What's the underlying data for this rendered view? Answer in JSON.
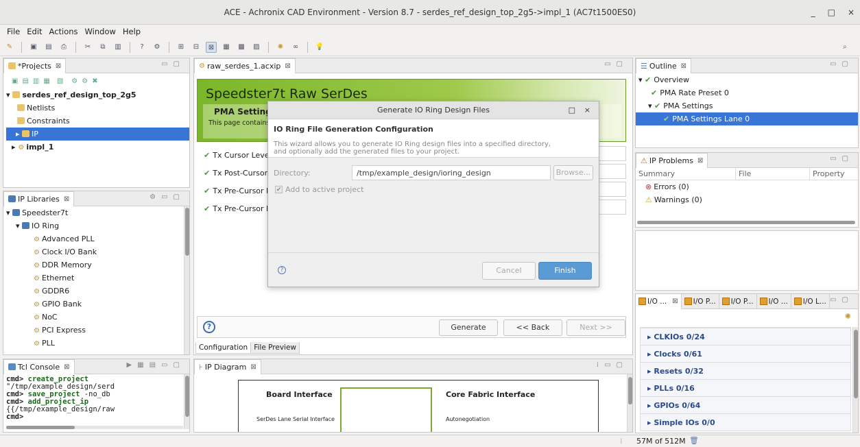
{
  "window": {
    "title": "ACE - Achronix CAD Environment - Version 8.7 - serdes_ref_design_top_2g5->impl_1 (AC7t1500ES0)",
    "minimize": "_",
    "maximize": "□",
    "close": "×"
  },
  "menu": [
    "File",
    "Edit",
    "Actions",
    "Window",
    "Help"
  ],
  "projects": {
    "tab_label": "*Projects",
    "root": "serdes_ref_design_top_2g5",
    "items": [
      "Netlists",
      "Constraints",
      "IP",
      "impl_1"
    ]
  },
  "ip_libraries": {
    "tab_label": "IP Libraries",
    "root": "Speedster7t",
    "group": "IO Ring",
    "items": [
      "Advanced PLL",
      "Clock I/O Bank",
      "DDR Memory",
      "Ethernet",
      "GDDR6",
      "GPIO Bank",
      "NoC",
      "PCI Express",
      "PLL"
    ]
  },
  "editor": {
    "tab_label": "raw_serdes_1.acxip",
    "header_title": "Speedster7t Raw SerDes",
    "section_title": "PMA Settings",
    "section_desc": "This page contains",
    "rows": [
      "Tx Cursor Level",
      "Tx Post-Cursor L",
      "Tx Pre-Cursor L",
      "Tx Pre-Cursor L"
    ],
    "buttons": {
      "generate": "Generate",
      "back": "<< Back",
      "next": "Next >>"
    },
    "bottom_tabs": [
      "Configuration",
      "File Preview"
    ]
  },
  "dialog": {
    "title": "Generate IO Ring Design Files",
    "heading": "IO Ring File Generation Configuration",
    "description_line1": "This wizard allows you to generate IO Ring design files into a specified directory,",
    "description_line2": "and optionally add the generated files to your project.",
    "directory_label": "Directory:",
    "directory_value": "/tmp/example_design/ioring_design",
    "browse": "Browse...",
    "checkbox_label": "Add to active project",
    "cancel": "Cancel",
    "finish": "Finish",
    "help": "?",
    "ctrl_max": "□",
    "ctrl_close": "×"
  },
  "outline": {
    "tab_label": "Outline",
    "items": [
      "Overview",
      "PMA Rate Preset 0",
      "PMA Settings",
      "PMA Settings Lane 0"
    ]
  },
  "ip_problems": {
    "tab_label": "IP Problems",
    "columns": [
      "Summary",
      "File",
      "Property"
    ],
    "rows": [
      "Errors (0)",
      "Warnings (0)"
    ]
  },
  "io_panel": {
    "tabs": [
      "I/O ...",
      "I/O P...",
      "I/O P...",
      "I/O ...",
      "I/O L..."
    ],
    "rows": [
      "CLKIOs 0/24",
      "Clocks 0/61",
      "Resets 0/32",
      "PLLs 0/16",
      "GPIOs 0/64",
      "Simple IOs 0/0"
    ]
  },
  "tcl": {
    "tab_label": "Tcl Console",
    "prompt": "cmd>",
    "lines": [
      {
        "cmd": "create_project",
        "arg": " \"/tmp/example_design/serd"
      },
      {
        "cmd": "save_project",
        "arg": " -no_db"
      },
      {
        "cmd": "add_project_ip",
        "arg": " {{/tmp/example_design/raw"
      },
      {
        "cmd": "",
        "arg": ""
      }
    ]
  },
  "ip_diagram": {
    "tab_label": "IP Diagram",
    "board_interface": "Board Interface",
    "board_sub": "SerDes Lane Serial Interface",
    "core_interface": "Core Fabric Interface",
    "core_sub": "Autonegotiation"
  },
  "status": {
    "memory": "57M of 512M"
  }
}
